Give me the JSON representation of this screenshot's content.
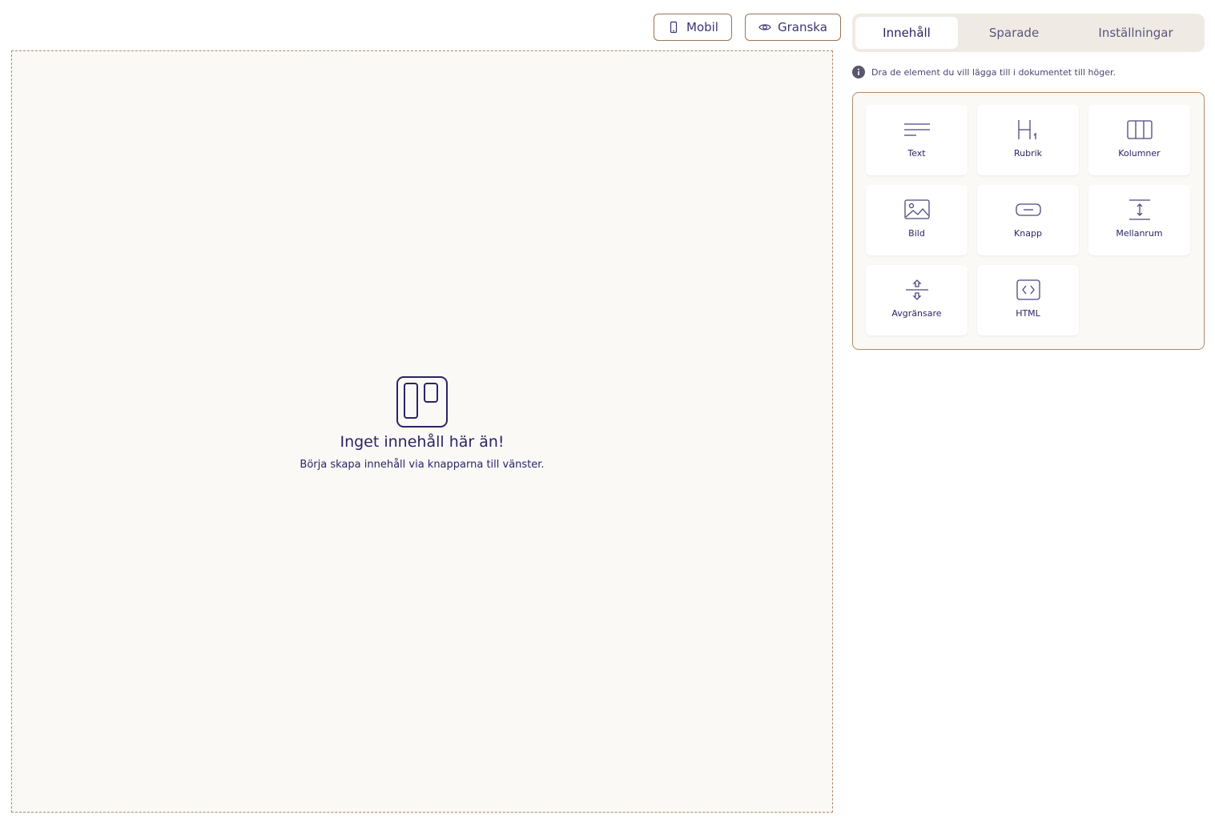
{
  "toolbar": {
    "mobile_label": "Mobil",
    "preview_label": "Granska"
  },
  "canvas": {
    "empty_title": "Inget innehåll här än!",
    "empty_subtitle": "Börja skapa innehåll via knapparna till vänster."
  },
  "panel": {
    "tabs": [
      {
        "label": "Innehåll",
        "active": true
      },
      {
        "label": "Sparade",
        "active": false
      },
      {
        "label": "Inställningar",
        "active": false
      }
    ],
    "hint": "Dra de element du vill lägga till i dokumentet till höger.",
    "elements": [
      {
        "label": "Text",
        "icon": "text-lines-icon"
      },
      {
        "label": "Rubrik",
        "icon": "heading-icon"
      },
      {
        "label": "Kolumner",
        "icon": "columns-icon"
      },
      {
        "label": "Bild",
        "icon": "image-icon"
      },
      {
        "label": "Knapp",
        "icon": "button-icon"
      },
      {
        "label": "Mellanrum",
        "icon": "spacer-icon"
      },
      {
        "label": "Avgränsare",
        "icon": "divider-icon"
      },
      {
        "label": "HTML",
        "icon": "code-icon"
      }
    ]
  },
  "colors": {
    "accent": "#2a2466",
    "border": "#b08a6a",
    "tab_bg": "#efebe4",
    "canvas_bg": "#faf9f6"
  }
}
